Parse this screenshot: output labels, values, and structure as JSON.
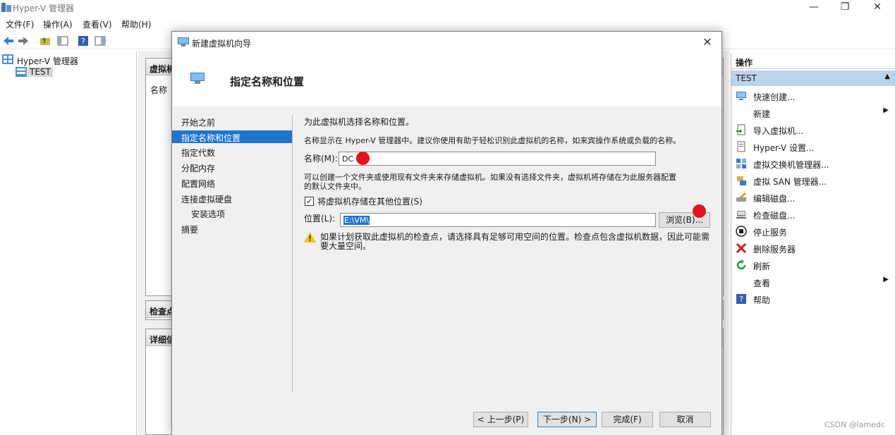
{
  "window": {
    "title": "Hyper-V 管理器",
    "min": "—",
    "restore": "❐",
    "close": "✕"
  },
  "menu": [
    "文件(F)",
    "操作(A)",
    "查看(V)",
    "帮助(H)"
  ],
  "tree": {
    "root": "Hyper-V 管理器",
    "server": "TEST"
  },
  "center": {
    "vm_pane_title": "虚拟机",
    "vm_col_name": "名称",
    "checkpoint_title": "检查点",
    "details_title": "详细信"
  },
  "actions": {
    "header": "操作",
    "group": "TEST",
    "items": [
      {
        "label": "快速创建...",
        "icon": "quick-create-icon",
        "submenu": false
      },
      {
        "label": "新建",
        "icon": "",
        "submenu": true
      },
      {
        "label": "导入虚拟机...",
        "icon": "import-icon",
        "submenu": false
      },
      {
        "label": "Hyper-V 设置...",
        "icon": "settings-icon",
        "submenu": false
      },
      {
        "label": "虚拟交换机管理器...",
        "icon": "switch-icon",
        "submenu": false
      },
      {
        "label": "虚拟 SAN 管理器...",
        "icon": "san-icon",
        "submenu": false
      },
      {
        "label": "编辑磁盘...",
        "icon": "edit-disk-icon",
        "submenu": false
      },
      {
        "label": "检查磁盘...",
        "icon": "inspect-disk-icon",
        "submenu": false
      },
      {
        "label": "停止服务",
        "icon": "stop-icon",
        "submenu": false
      },
      {
        "label": "删除服务器",
        "icon": "delete-icon",
        "submenu": false
      },
      {
        "label": "刷新",
        "icon": "refresh-icon",
        "submenu": false
      },
      {
        "label": "查看",
        "icon": "",
        "submenu": true
      },
      {
        "label": "帮助",
        "icon": "help-icon",
        "submenu": false
      }
    ]
  },
  "dialog": {
    "title": "新建虚拟机向导",
    "heading": "指定名称和位置",
    "steps": [
      {
        "label": "开始之前",
        "active": false,
        "sub": false
      },
      {
        "label": "指定名称和位置",
        "active": true,
        "sub": false
      },
      {
        "label": "指定代数",
        "active": false,
        "sub": false
      },
      {
        "label": "分配内存",
        "active": false,
        "sub": false
      },
      {
        "label": "配置网络",
        "active": false,
        "sub": false
      },
      {
        "label": "连接虚拟硬盘",
        "active": false,
        "sub": false
      },
      {
        "label": "安装选项",
        "active": false,
        "sub": true
      },
      {
        "label": "摘要",
        "active": false,
        "sub": false
      }
    ],
    "intro": "为此虚拟机选择名称和位置。",
    "name_hint": "名称显示在 Hyper-V 管理器中。建议你使用有助于轻松识别此虚拟机的名称，如来宾操作系统或负载的名称。",
    "name_label": "名称(M):",
    "name_value": "DC",
    "folder_hint_1": "可以创建一个文件夹或使用现有文件夹来存储虚拟机。如果没有选择文件夹，虚拟机将存储在为此服务器配置",
    "folder_hint_2": "的默认文件夹中。",
    "store_checkbox_label": "将虚拟机存储在其他位置(S)",
    "store_checked": true,
    "location_label": "位置(L):",
    "location_value": "E:\\VM\\",
    "browse_label": "浏览(B)...",
    "warning_1": "如果计划获取此虚拟机的检查点，请选择具有足够可用空间的位置。检查点包含虚拟机数据，因此可能需",
    "warning_2": "要大量空间。",
    "buttons": {
      "prev": "< 上一步(P)",
      "next": "下一步(N) >",
      "finish": "完成(F)",
      "cancel": "取消"
    }
  },
  "watermark": "CSDN @lamedc",
  "colors": {
    "accent": "#1e75d0",
    "group_bar": "#bcd3ec",
    "annotation_dot": "#e5141b"
  }
}
